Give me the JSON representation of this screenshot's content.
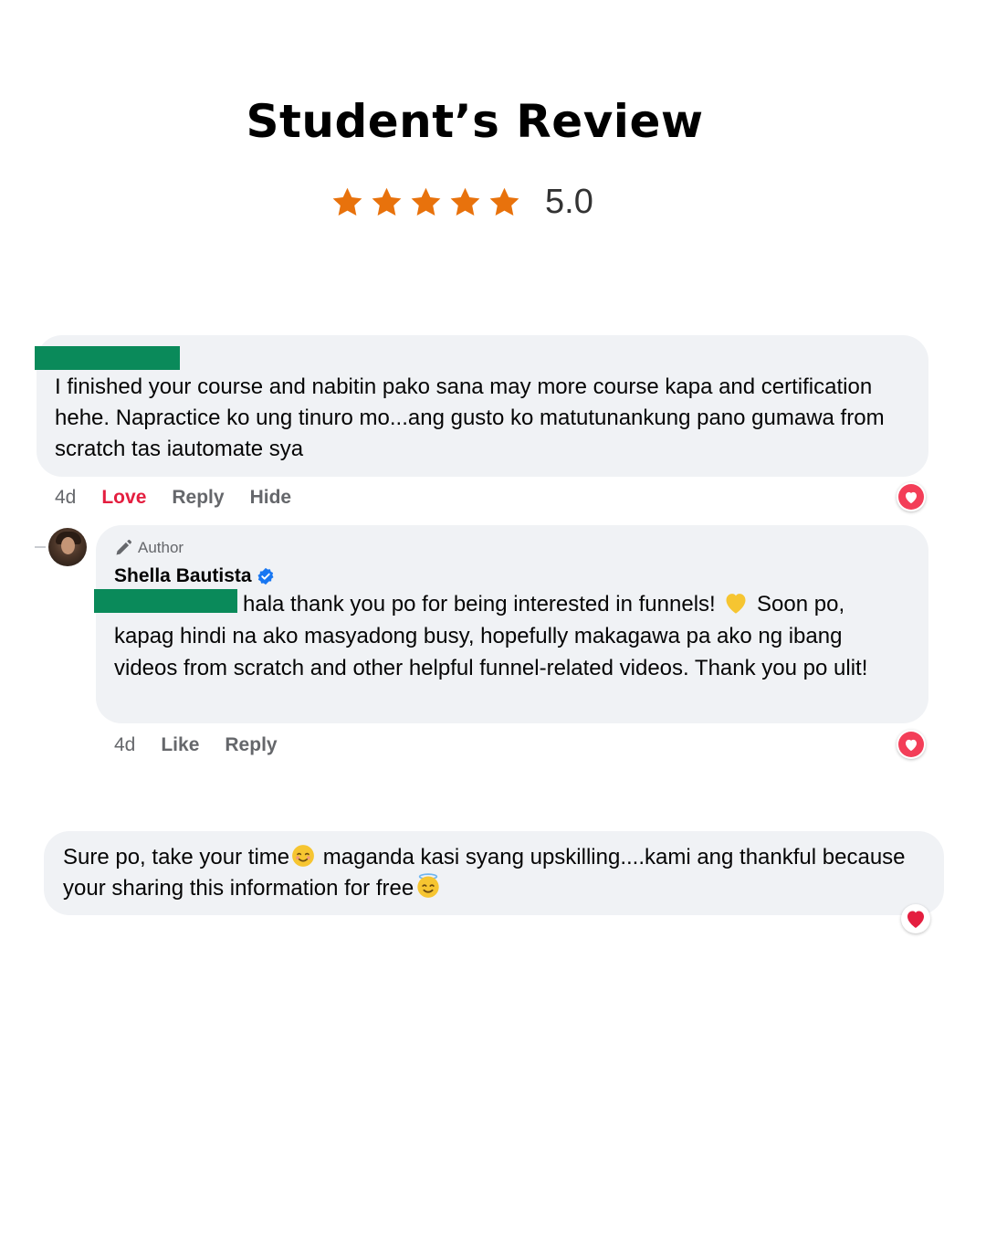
{
  "title": "Student’s Review",
  "rating": {
    "value": "5.0",
    "stars": 5,
    "star_color": "#e8720c"
  },
  "comment1": {
    "text": "I finished your course and nabitin pako sana may more course kapa and certification hehe. Napractice ko ung tinuro mo...ang gusto ko matutunankung pano gumawa from scratch tas iautomate sya",
    "actions": {
      "time": "4d",
      "reaction": "Love",
      "reply": "Reply",
      "hide": "Hide"
    },
    "reaction_icon": "heart-icon"
  },
  "reply": {
    "badge": "Author",
    "author": "Shella Bautista",
    "text_part1": "hala thank you po for being interested in funnels!",
    "text_part2": "Soon po, kapag hindi na ako masyadong busy, hopefully makagawa pa ako ng ibang videos from scratch and other helpful funnel-related videos. Thank you po ulit!",
    "actions": {
      "time": "4d",
      "like": "Like",
      "reply": "Reply"
    },
    "reaction_icon": "heart-icon"
  },
  "comment2": {
    "text_part1": "Sure po, take your time",
    "text_part2": "maganda kasi syang upskilling....kami ang thankful because your sharing this information for free",
    "reaction_icon": "heart-icon"
  },
  "colors": {
    "bubble": "#f0f2f5",
    "love": "#e41e3f",
    "redaction": "#0a8a5a",
    "verified": "#1877f2"
  }
}
